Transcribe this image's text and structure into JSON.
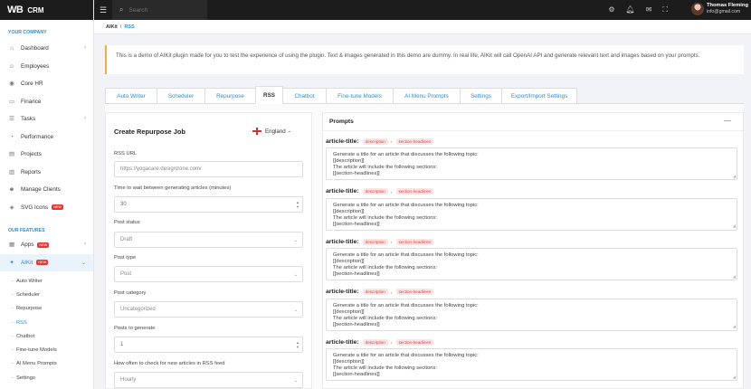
{
  "app": {
    "logo_mark": "WB",
    "logo_name": "CRM"
  },
  "sidebar": {
    "section_company": "YOUR COMPANY",
    "company_items": [
      {
        "label": "Dashboard",
        "icon": "home-icon",
        "chevron": true
      },
      {
        "label": "Employees",
        "icon": "users-icon",
        "chevron": false
      },
      {
        "label": "Core HR",
        "icon": "user-icon",
        "chevron": false
      },
      {
        "label": "Finance",
        "icon": "finance-icon",
        "chevron": false
      },
      {
        "label": "Tasks",
        "icon": "tasks-icon",
        "chevron": true
      },
      {
        "label": "Performance",
        "icon": "performance-icon",
        "chevron": false
      },
      {
        "label": "Projects",
        "icon": "projects-icon",
        "chevron": false
      },
      {
        "label": "Reports",
        "icon": "reports-icon",
        "chevron": false
      },
      {
        "label": "Manage Clients",
        "icon": "clients-icon",
        "chevron": false
      },
      {
        "label": "SVG Icons",
        "icon": "svg-icon",
        "badge": "NEW"
      }
    ],
    "section_features": "OUR FEATURES",
    "apps_label": "Apps",
    "apps_badge": "NEW",
    "aikit_label": "AIKit",
    "aikit_badge": "NEW",
    "sub_items": [
      "Auto Writer",
      "Scheduler",
      "Repurpose",
      "RSS",
      "Chatbot",
      "Fine-tune Models",
      "AI Menu Prompts",
      "Settings"
    ]
  },
  "topbar": {
    "search_placeholder": "Search",
    "user_name": "Thomas Fleming",
    "user_email": "info@gmail.com"
  },
  "breadcrumb": {
    "root": "AIKit",
    "sep": "/",
    "current": "RSS"
  },
  "notice": "This is a demo of AIKit plugin made for you to test the experience of using the plugin. Text & images generated in this demo are dummy. In real life, AIKit will call OpenAI API and generate relevant text and images based on your prompts.",
  "tabs": [
    {
      "label": "Auto Writer",
      "width": 58
    },
    {
      "label": "Scheduler",
      "width": 54
    },
    {
      "label": "Repurpose",
      "width": 57
    },
    {
      "label": "RSS",
      "width": 31,
      "active": true
    },
    {
      "label": "Chatbot",
      "width": 49
    },
    {
      "label": "Fine-tune Models",
      "width": 75
    },
    {
      "label": "AI Menu Prompts",
      "width": 75
    },
    {
      "label": "Settings",
      "width": 47
    },
    {
      "label": "Export/Import Settings",
      "width": 84
    }
  ],
  "form": {
    "title": "Create Repurpose Job",
    "language": "England",
    "rss_url_label": "RSS URL",
    "rss_url_placeholder": "https://yogacare.designzone.com/",
    "wait_label": "Time to wait between generating articles (minutes)",
    "wait_value": "30",
    "status_label": "Post status",
    "status_value": "Draft",
    "type_label": "Post type",
    "type_value": "Post",
    "category_label": "Post category",
    "category_value": "Uncategorized",
    "posts_label": "Posts to generate",
    "posts_value": "1",
    "check_label": "How often to check for new articles in RSS feed",
    "check_value": "Hourly"
  },
  "prompts": {
    "title": "Prompts",
    "minimize": "—",
    "items": [
      {
        "label": "article-title:",
        "tags": [
          "description",
          "section-headlines"
        ],
        "lines": [
          "Generate a title for an article that discusses the following topic:",
          "[[description]]",
          "The article will include the following sections:",
          "[[section-headlines]]"
        ]
      },
      {
        "label": "article-title:",
        "tags": [
          "description",
          "section-headlines"
        ],
        "lines": [
          "Generate a title for an article that discusses the following topic:",
          "[[description]]",
          "The article will include the following sections:",
          "[[section-headlines]]"
        ]
      },
      {
        "label": "article-title:",
        "tags": [
          "description",
          "section-headlines"
        ],
        "lines": [
          "Generate a title for an article that discusses the following topic:",
          "[[description]]",
          "The article will include the following sections:",
          "[[section-headlines]]"
        ]
      },
      {
        "label": "article-title:",
        "tags": [
          "description",
          "section-headlines"
        ],
        "lines": [
          "Generate a title for an article that discusses the following topic:",
          "[[description]]",
          "The article will include the following sections:",
          "[[section-headlines]]"
        ]
      },
      {
        "label": "article-title:",
        "tags": [
          "description",
          "section-headlines"
        ],
        "lines": [
          "Generate a title for an article that discusses the following topic:",
          "[[description]]",
          "The article will include the following sections:",
          "[[section-headlines]]"
        ]
      }
    ]
  }
}
